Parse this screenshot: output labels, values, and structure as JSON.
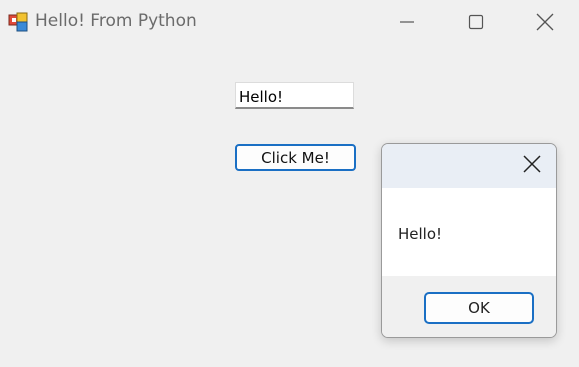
{
  "window": {
    "title": "Hello! From Python",
    "icon": "winforms-app-icon",
    "controls": {
      "minimize_icon": "minimize-icon",
      "maximize_icon": "maximize-icon",
      "close_icon": "close-icon"
    }
  },
  "form": {
    "textbox_value": "Hello!",
    "button_label": "Click Me!"
  },
  "message_box": {
    "close_icon": "close-icon",
    "message": "Hello!",
    "ok_label": "OK"
  },
  "colors": {
    "accent": "#1a6fc4",
    "window_background": "#f0f0f0",
    "title_text": "#6b6b6b"
  }
}
